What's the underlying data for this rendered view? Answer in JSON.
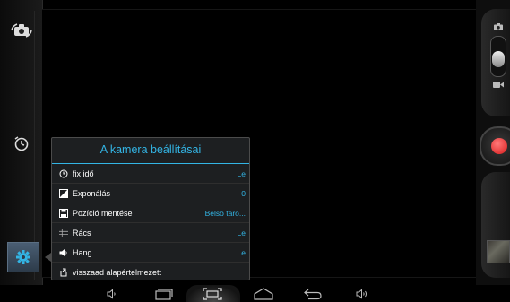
{
  "settings_panel": {
    "title": "A kamera beállításai",
    "rows": [
      {
        "icon": "clock-icon",
        "label": "fix idő",
        "value": "Le"
      },
      {
        "icon": "exposure-icon",
        "label": "Exponálás",
        "value": "0"
      },
      {
        "icon": "save-icon",
        "label": "Pozíció mentése",
        "value": "Belső táro..."
      },
      {
        "icon": "grid-icon",
        "label": "Rács",
        "value": "Le"
      },
      {
        "icon": "speaker-icon",
        "label": "Hang",
        "value": "Le"
      },
      {
        "icon": "reset-icon",
        "label": "visszaad alapértelmezett",
        "value": ""
      }
    ]
  },
  "left_bar": {
    "items": [
      "switch-camera-icon",
      "timer-icon",
      "settings-gear-icon"
    ]
  },
  "right_bar": {
    "mode_icons": [
      "camera-icon",
      "video-icon"
    ],
    "mode": "camera"
  },
  "nav_bar": {
    "buttons": [
      "volume-down-icon",
      "recents-icon",
      "screenshot-icon",
      "home-icon",
      "back-icon",
      "volume-up-icon"
    ],
    "active": "screenshot-icon"
  },
  "colors": {
    "accent": "#33b5e5",
    "shutter": "#d71a1a",
    "panel_bg": "#1d1f21"
  }
}
